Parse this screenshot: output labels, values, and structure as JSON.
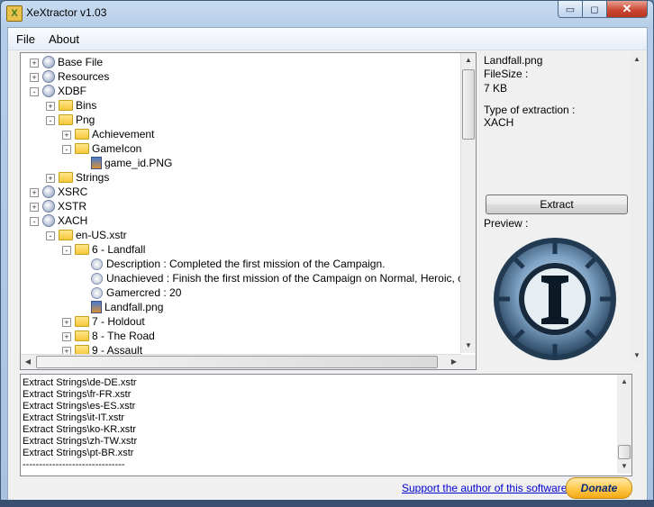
{
  "window": {
    "title": "XeXtractor v1.03",
    "min_glyph": "▭",
    "max_glyph": "◻",
    "close_glyph": "✕"
  },
  "menu": {
    "file": "File",
    "about": "About"
  },
  "tree": {
    "nodes": [
      {
        "label": "Base File",
        "depth": 0,
        "icon": "gear-icon",
        "state": "+"
      },
      {
        "label": "Resources",
        "depth": 0,
        "icon": "gear-icon",
        "state": "+"
      },
      {
        "label": "XDBF",
        "depth": 0,
        "icon": "gear-icon",
        "state": "-"
      },
      {
        "label": "Bins",
        "depth": 1,
        "icon": "folder-icon",
        "state": "+"
      },
      {
        "label": "Png",
        "depth": 1,
        "icon": "folder-icon",
        "state": "-"
      },
      {
        "label": "Achievement",
        "depth": 2,
        "icon": "folder-icon",
        "state": "+"
      },
      {
        "label": "GameIcon",
        "depth": 2,
        "icon": "folder-icon",
        "state": "-"
      },
      {
        "label": "game_id.PNG",
        "depth": 3,
        "icon": "image-file-icon",
        "state": ""
      },
      {
        "label": "Strings",
        "depth": 1,
        "icon": "folder-icon",
        "state": "+"
      },
      {
        "label": "XSRC",
        "depth": 0,
        "icon": "gear-icon",
        "state": "+"
      },
      {
        "label": "XSTR",
        "depth": 0,
        "icon": "gear-icon",
        "state": "+"
      },
      {
        "label": "XACH",
        "depth": 0,
        "icon": "gear-icon",
        "state": "-"
      },
      {
        "label": "en-US.xstr",
        "depth": 1,
        "icon": "folder-icon",
        "state": "-"
      },
      {
        "label": "6 - Landfall",
        "depth": 2,
        "icon": "folder-icon",
        "state": "-"
      },
      {
        "label": "Description : Completed the first mission of the Campaign.",
        "depth": 3,
        "icon": "data-icon",
        "state": ""
      },
      {
        "label": "Unachieved : Finish the first mission of the Campaign on Normal, Heroic, or Legend",
        "depth": 3,
        "icon": "data-icon",
        "state": ""
      },
      {
        "label": "Gamercred : 20",
        "depth": 3,
        "icon": "data-icon",
        "state": ""
      },
      {
        "label": "Landfall.png",
        "depth": 3,
        "icon": "image-file-icon",
        "state": ""
      },
      {
        "label": "7 - Holdout",
        "depth": 2,
        "icon": "folder-icon",
        "state": "+"
      },
      {
        "label": "8 - The Road",
        "depth": 2,
        "icon": "folder-icon",
        "state": "+"
      },
      {
        "label": "9 - Assault",
        "depth": 2,
        "icon": "folder-icon",
        "state": "+"
      }
    ]
  },
  "details": {
    "filename": "Landfall.png",
    "filesize_label": "FileSize :",
    "filesize_value": "7 KB",
    "type_label": "Type of extraction :",
    "type_value": "XACH",
    "extract_label": "Extract",
    "preview_label": "Preview :"
  },
  "log": {
    "lines": [
      "Extract Strings\\de-DE.xstr",
      "Extract Strings\\fr-FR.xstr",
      "Extract Strings\\es-ES.xstr",
      "Extract Strings\\it-IT.xstr",
      "Extract Strings\\ko-KR.xstr",
      "Extract Strings\\zh-TW.xstr",
      "Extract Strings\\pt-BR.xstr",
      "-------------------------------"
    ]
  },
  "footer": {
    "support": "Support the author of this software :",
    "donate": "Donate"
  },
  "colors": {
    "folder": "#f5c73a",
    "link": "#0000d0",
    "donate": "#ffc84a"
  }
}
